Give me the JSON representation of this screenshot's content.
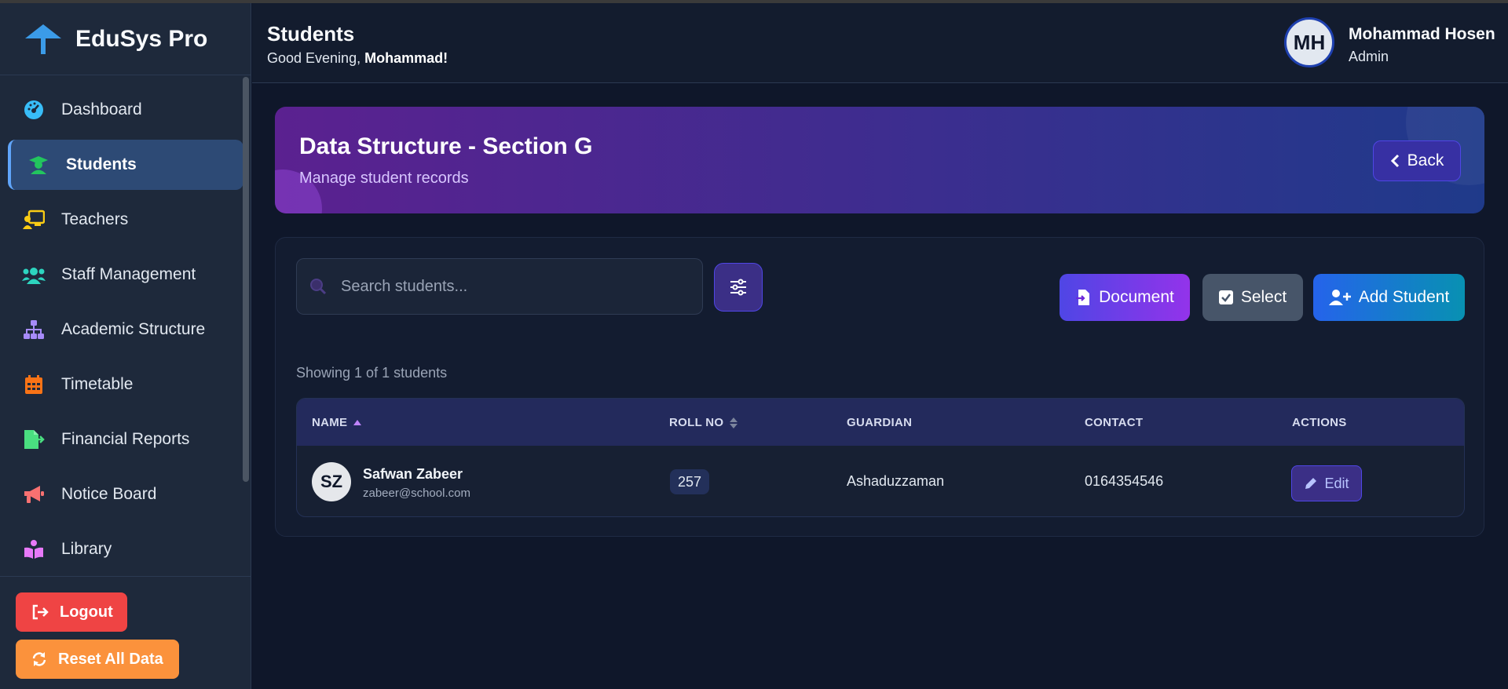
{
  "app": {
    "name": "EduSys Pro",
    "accent": "#60a5fa"
  },
  "sidebar": {
    "items": [
      {
        "label": "Dashboard",
        "icon": "gauge-icon",
        "color": "#38bdf8"
      },
      {
        "label": "Students",
        "icon": "graduate-icon",
        "color": "#22c55e",
        "active": true
      },
      {
        "label": "Teachers",
        "icon": "chalkboard-teacher-icon",
        "color": "#facc15"
      },
      {
        "label": "Staff Management",
        "icon": "users-icon",
        "color": "#2dd4bf"
      },
      {
        "label": "Academic Structure",
        "icon": "sitemap-icon",
        "color": "#a78bfa"
      },
      {
        "label": "Timetable",
        "icon": "calendar-icon",
        "color": "#f97316"
      },
      {
        "label": "Financial Reports",
        "icon": "file-export-icon",
        "color": "#4ade80"
      },
      {
        "label": "Notice Board",
        "icon": "bullhorn-icon",
        "color": "#f87171"
      },
      {
        "label": "Library",
        "icon": "book-reader-icon",
        "color": "#e879f9"
      }
    ],
    "logout_label": "Logout",
    "reset_label": "Reset All Data"
  },
  "header": {
    "title": "Students",
    "greeting_prefix": "Good Evening, ",
    "greeting_name": "Mohammad!",
    "user": {
      "initials": "MH",
      "name": "Mohammad Hosen",
      "role": "Admin"
    }
  },
  "banner": {
    "title": "Data Structure - Section G",
    "subtitle": "Manage student records",
    "back_label": "Back"
  },
  "toolbar": {
    "search_placeholder": "Search students...",
    "document_label": "Document",
    "select_label": "Select",
    "add_label": "Add Student"
  },
  "results": {
    "showing_text": "Showing 1 of 1 students"
  },
  "table": {
    "columns": [
      "NAME",
      "ROLL NO",
      "GUARDIAN",
      "CONTACT",
      "ACTIONS"
    ],
    "rows": [
      {
        "initials": "SZ",
        "name": "Safwan Zabeer",
        "email": "zabeer@school.com",
        "roll": "257",
        "guardian": "Ashaduzzaman",
        "contact": "0164354546",
        "action_label": "Edit"
      }
    ]
  }
}
